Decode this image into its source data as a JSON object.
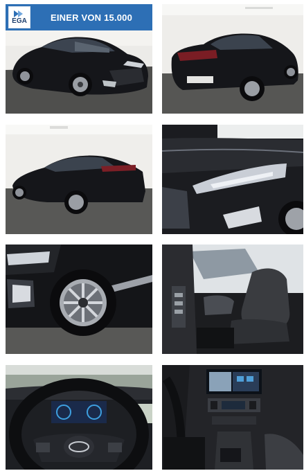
{
  "badge": {
    "logo_text": "EGA",
    "text": "EINER VON 15.000",
    "color": "#2d6fb5"
  },
  "gallery": {
    "photos": [
      "car-front-left-exterior",
      "car-rear-right-exterior",
      "car-rear-left-exterior",
      "headlight-detail",
      "front-wheel-detail",
      "driver-seat-interior",
      "steering-wheel-cockpit",
      "center-console-infotainment"
    ]
  }
}
